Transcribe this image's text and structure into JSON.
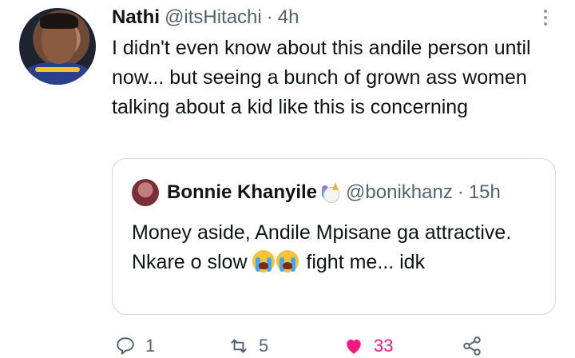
{
  "tweet": {
    "author_name": "Nathi",
    "author_handle": "@itsHitachi",
    "separator": "·",
    "time": "4h",
    "text": "I didn't even know about this andile  person until now... but seeing a bunch of grown ass women talking about a kid like this is concerning"
  },
  "quote": {
    "author_name": "Bonnie Khanyile",
    "author_handle": "@bonikhanz",
    "separator": "·",
    "time": "15h",
    "text_before": "Money aside, Andile Mpisane ga attractive. Nkare o slow ",
    "text_after": " fight me... idk"
  },
  "actions": {
    "reply_count": "1",
    "retweet_count": "5",
    "like_count": "33",
    "like_color": "#f91880"
  },
  "icons": [
    "more-icon",
    "reply-icon",
    "retweet-icon",
    "heart-icon",
    "share-icon",
    "unicorn-emoji-icon",
    "crying-face-emoji-icon"
  ]
}
